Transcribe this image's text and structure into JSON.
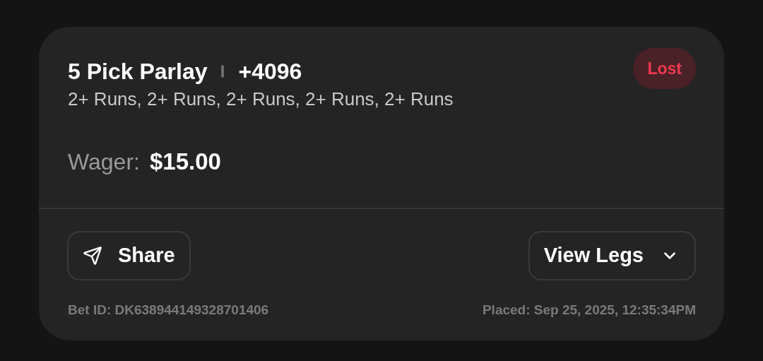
{
  "bet": {
    "title": "5 Pick Parlay",
    "odds": "+4096",
    "legs_summary": "2+ Runs, 2+ Runs, 2+ Runs, 2+ Runs, 2+ Runs",
    "status": {
      "label": "Lost",
      "kind": "lost"
    },
    "wager_label": "Wager:",
    "wager_amount": "$15.00",
    "share_button": "Share",
    "view_legs_button": "View Legs",
    "bet_id": "Bet ID: DK638944149328701406",
    "placed": "Placed: Sep 25, 2025, 12:35:34PM"
  }
}
